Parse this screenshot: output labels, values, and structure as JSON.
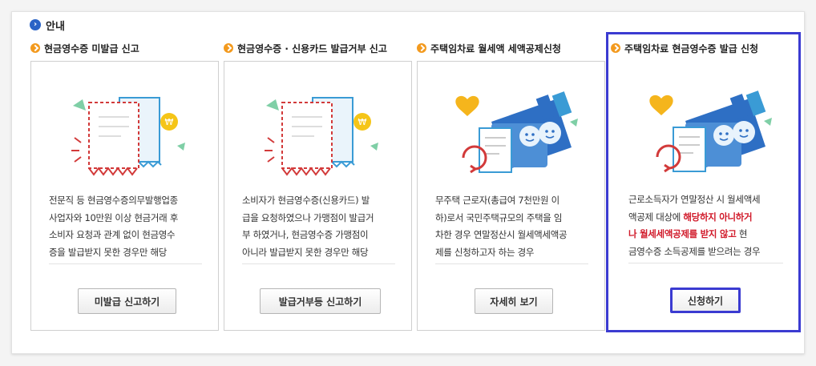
{
  "header": {
    "title": "안내"
  },
  "cards": [
    {
      "heading": "현금영수증 미발급 신고",
      "lines": [
        "전문직 등 현금영수증의무발행업종",
        "사업자와 10만원 이상 현금거래 후",
        "소비자 요청과 관계 없이 현금영수",
        "증을 발급받지 못한 경우만 해당"
      ],
      "button": "미발급 신고하기"
    },
    {
      "heading": "현금영수증 · 신용카드 발급거부 신고",
      "lines": [
        "소비자가 현금영수증(신용카드) 발",
        "급을 요청하였으나 가맹점이 발급거",
        "부 하였거나, 현금영수증 가맹점이",
        "아니라 발급받지 못한 경우만 해당"
      ],
      "button": "발급거부등 신고하기"
    },
    {
      "heading": "주택임차료 월세액 세액공제신청",
      "lines": [
        "무주택 근로자(총급여 7천만원 이",
        "하)로서 국민주택규모의 주택을 임",
        "차한 경우 연말정산시 월세액세액공",
        "제를 신청하고자 하는 경우"
      ],
      "button": "자세히 보기"
    },
    {
      "heading": "주택임차료 현금영수증 발급 신청",
      "line1": "근로소득자가 연말정산 시 월세액세",
      "line2_pre": "액공제 대상에 ",
      "line2_hl": "해당하지 아니하거",
      "line3_hl": "나 월세세액공제를 받지 않고",
      "line3_post": " 현",
      "line4": "금영수증 소득공제를 받으려는 경우",
      "button": "신청하기"
    }
  ],
  "colors": {
    "accent": "#3b3bd1",
    "bullet": "#f39a1e",
    "highlight_text": "#d11a2a",
    "title_icon": "#2a63c6"
  }
}
